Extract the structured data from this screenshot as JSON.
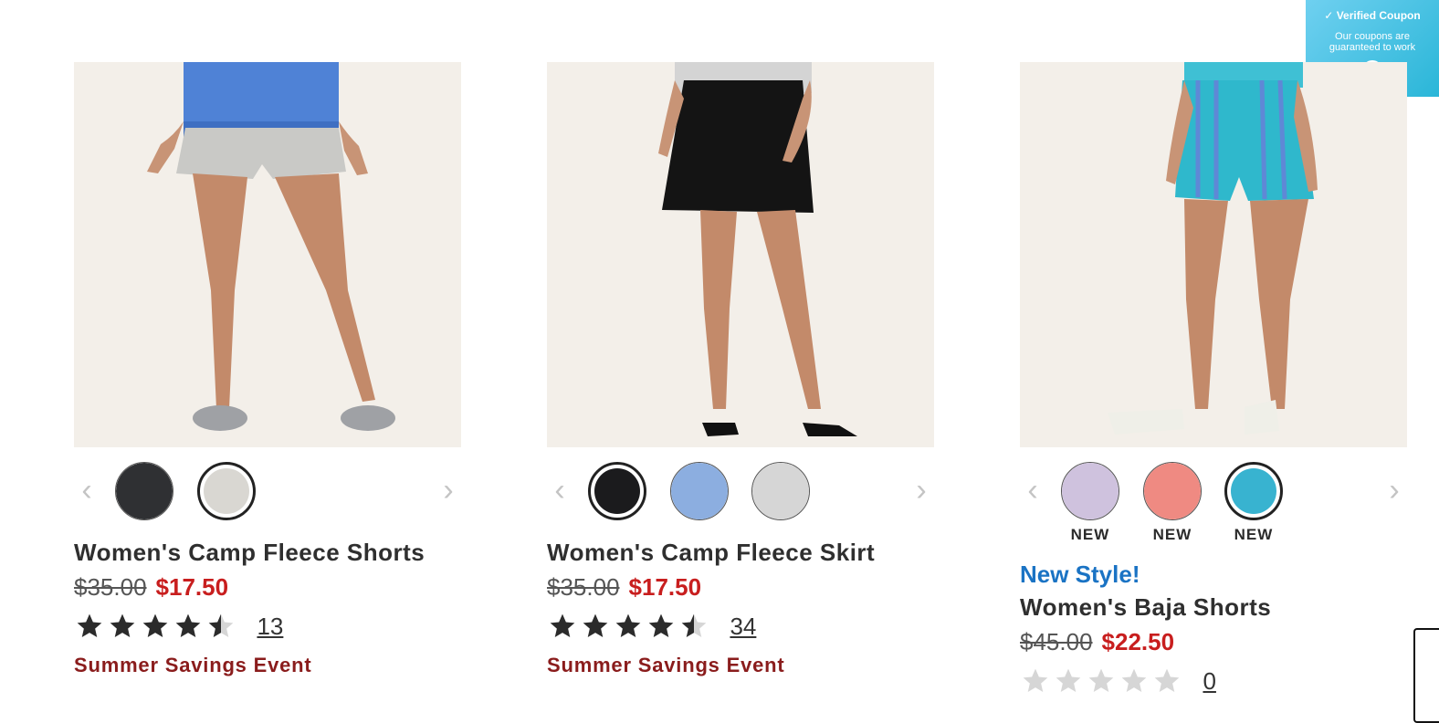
{
  "coupon": {
    "title": "Verified Coupon",
    "subtitle": "Our coupons are guaranteed to work",
    "check_icon": "✓",
    "logo_icon": "◇",
    "gradient": [
      "#6fd0f0",
      "#2ab6d8"
    ]
  },
  "products": [
    {
      "name": "Women's Camp Fleece Shorts",
      "original_price": "$35.00",
      "sale_price": "$17.50",
      "rating": 4.5,
      "review_count": "13",
      "promo": "Summer Savings Event",
      "swatches": [
        {
          "color": "#2f3033",
          "selected": false
        },
        {
          "color": "#d9d7d2",
          "selected": true
        }
      ]
    },
    {
      "name": "Women's Camp Fleece Skirt",
      "original_price": "$35.00",
      "sale_price": "$17.50",
      "rating": 4.5,
      "review_count": "34",
      "promo": "Summer Savings Event",
      "swatches": [
        {
          "color": "#1b1b1d",
          "selected": true
        },
        {
          "color": "#8caee0",
          "selected": false
        },
        {
          "color": "#d6d6d6",
          "selected": false
        }
      ]
    },
    {
      "badge": "New Style!",
      "name": "Women's Baja Shorts",
      "original_price": "$45.00",
      "sale_price": "$22.50",
      "rating": 0,
      "review_count": "0",
      "swatches": [
        {
          "color": "#cfc2de",
          "selected": false,
          "new_label": "NEW"
        },
        {
          "color": "#ef8a82",
          "selected": false,
          "new_label": "NEW"
        },
        {
          "color": "#38b3d0",
          "selected": true,
          "new_label": "NEW"
        }
      ]
    }
  ],
  "carousel": {
    "prev_icon": "‹",
    "next_icon": "›"
  },
  "colors": {
    "sale": "#c81e1e",
    "promo": "#8a1c1c",
    "new_style": "#1a73c4",
    "star": "#2b2b2b",
    "star_empty": "#d6d6d6"
  }
}
